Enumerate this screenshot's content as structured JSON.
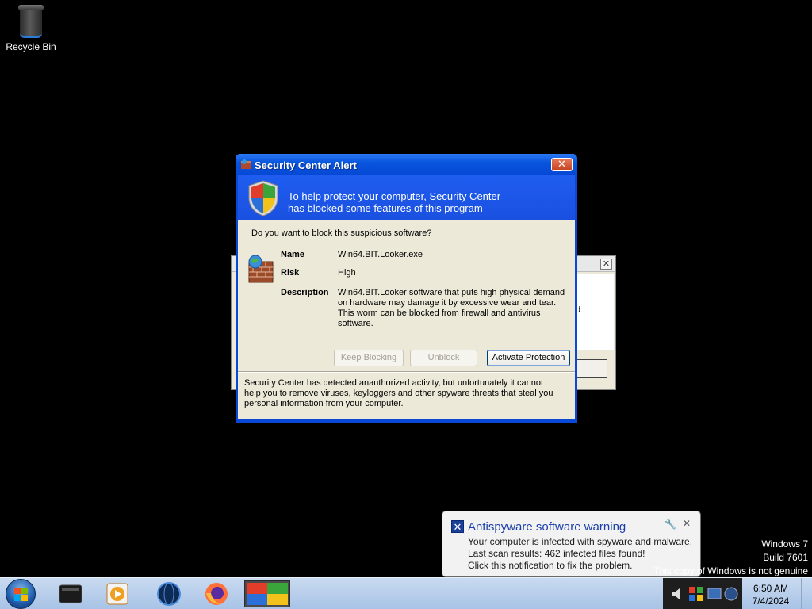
{
  "desktop": {
    "icons": [
      {
        "label": "Recycle Bin",
        "icon": "recycle-bin-icon"
      }
    ]
  },
  "alert_dialog": {
    "title": "Security Center Alert",
    "header_line1": "To help protect your computer, Security Center",
    "header_line2": "has blocked some features of this program",
    "question": "Do you want to block this suspicious software?",
    "name_label": "Name",
    "name_value": "Win64.BIT.Looker.exe",
    "risk_label": "Risk",
    "risk_value": "High",
    "description_label": "Description",
    "description_value": "Win64.BIT.Looker software that puts high physical demand on hardware may damage it by excessive wear and tear. This worm can be blocked from firewall and antivirus software.",
    "buttons": {
      "keep_blocking": "Keep Blocking",
      "unblock": "Unblock",
      "activate": "Activate Protection"
    },
    "footer": "Security Center has detected anauthorized activity, but unfortunately it cannot help you to remove viruses, keyloggers and other spyware threats that steal you personal information from your computer."
  },
  "background_dialog": {
    "text_fragment": "d"
  },
  "notification": {
    "title": "Antispyware software warning",
    "line1": "Your computer is infected with spyware and malware.",
    "line2": "Last scan results: 462 infected files found!",
    "line3": "Click this notification to fix the problem."
  },
  "watermark": {
    "line1": "Windows 7",
    "line2": "Build 7601",
    "line3": "This copy of Windows is not genuine"
  },
  "taskbar": {
    "pinned": [
      "app-icon",
      "media-player-icon",
      "globe-icon",
      "firefox-icon",
      "security-app-icon"
    ],
    "clock_time": "6:50 AM",
    "clock_date": "7/4/2024"
  },
  "colors": {
    "title_blue": "#0648d4",
    "dialog_bg": "#ECE9D8",
    "notification_title": "#1a3fa8"
  }
}
